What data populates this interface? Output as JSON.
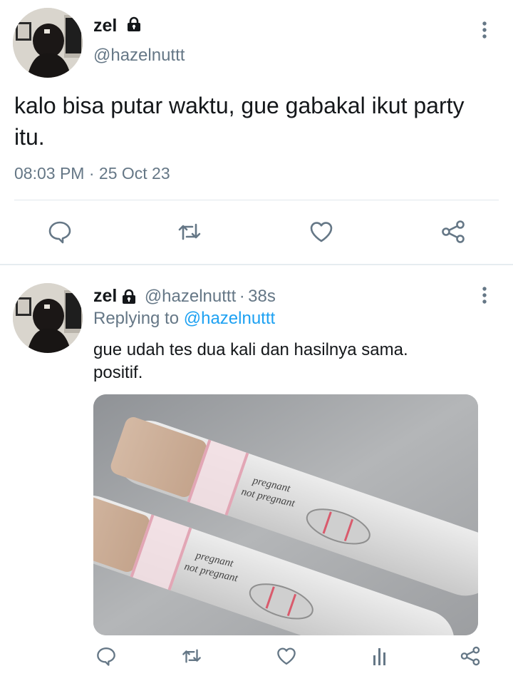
{
  "tweet": {
    "author_name": "zel",
    "author_handle": "@hazelnuttt",
    "text": "kalo bisa putar waktu, gue gabakal ikut party itu.",
    "time": "08:03 PM",
    "separator": "·",
    "date": "25 Oct 23"
  },
  "reply": {
    "author_name": "zel",
    "author_handle": "@hazelnuttt",
    "separator": "·",
    "age": "38s",
    "replying_prefix": "Replying to",
    "replying_handle": "@hazelnuttt",
    "text": "gue udah tes dua kali dan hasilnya sama. positif.",
    "media": {
      "test1_label_top": "pregnant",
      "test1_label_bottom": "not pregnant",
      "test2_label_top": "pregnant",
      "test2_label_bottom": "not pregnant"
    }
  },
  "colors": {
    "link": "#1da1f2",
    "secondary": "#657786",
    "divider": "#e1e8ed"
  },
  "icons": {
    "lock": "lock-icon",
    "more": "more-vertical-icon",
    "reply": "speech-bubble-icon",
    "retweet": "retweet-icon",
    "like": "heart-icon",
    "share": "share-icon",
    "analytics": "bar-chart-icon"
  }
}
